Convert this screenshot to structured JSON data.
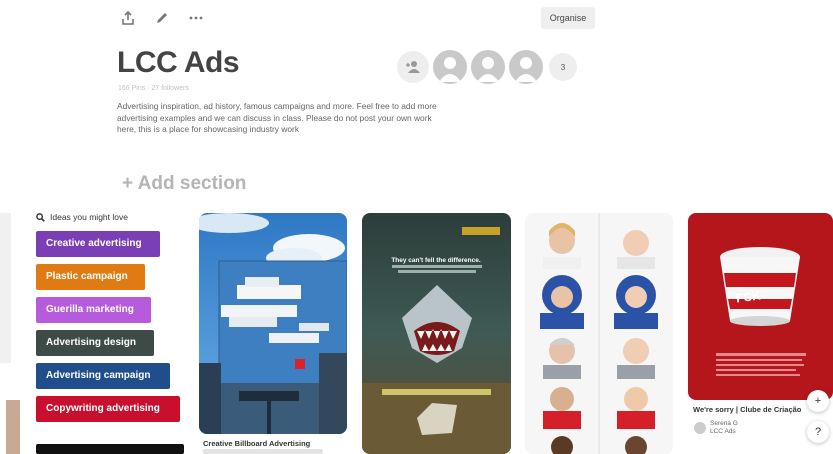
{
  "toolbar": {
    "icons": [
      "share-icon",
      "pencil-icon",
      "more-icon"
    ],
    "organise_label": "Organise"
  },
  "board": {
    "title": "LCC Ads",
    "meta": "166 Pins · 27 followers",
    "description": "Advertising inspiration, ad history, famous campaigns and more. Feel free to add more advertising examples and we can discuss in class. Please do not post your own work here, this is a place for showcasing industry work"
  },
  "collaborators": {
    "add_icon": "add-person-icon",
    "more_count": "3"
  },
  "add_section_label": "+ Add section",
  "ideas": {
    "heading": "Ideas you might love",
    "chips": [
      {
        "label": "Creative advertising",
        "color": "#7b3fb5"
      },
      {
        "label": "Plastic campaign",
        "color": "#e07b13"
      },
      {
        "label": "Guerilla marketing",
        "color": "#b65bdb"
      },
      {
        "label": "Advertising design",
        "color": "#3d4a45"
      },
      {
        "label": "Advertising campaign",
        "color": "#1f4e8a"
      },
      {
        "label": "Copywriting advertising",
        "color": "#c8102e"
      }
    ]
  },
  "pins": {
    "lego": {
      "caption": "Creative Billboard Advertising"
    },
    "shark": {
      "headline": "They can't fell the difference."
    },
    "kfc": {
      "caption": "We're sorry | Clube de Criação",
      "pinner_name": "Serena G",
      "pinner_board": "LCC Ads",
      "bucket_text": "FCK"
    }
  },
  "fab": {
    "plus": "+",
    "help": "?"
  }
}
